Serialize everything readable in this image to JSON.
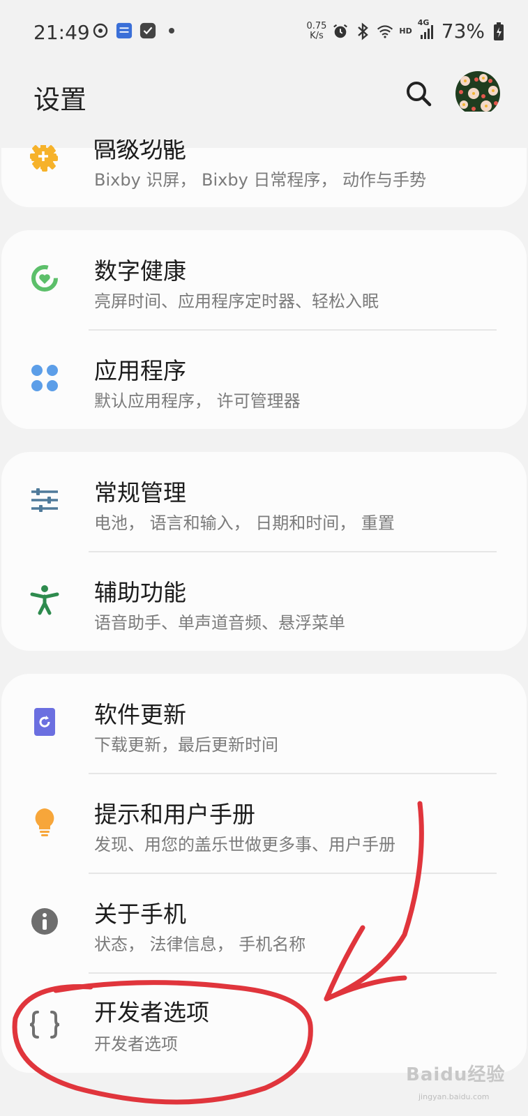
{
  "status_bar": {
    "time": "21:49",
    "speed_value": "0.75",
    "speed_unit": "K/s",
    "net_tag": "HD",
    "signal_tag": "4G",
    "battery": "73%",
    "icons": [
      "weibo-icon",
      "app-icon",
      "check-icon",
      "dot-icon",
      "alarm-icon",
      "bluetooth-icon",
      "wifi-icon",
      "signal-icon",
      "battery-icon"
    ]
  },
  "header": {
    "title": "设置",
    "search_icon": "search-icon",
    "avatar": "avatar"
  },
  "groups": [
    {
      "items": [
        {
          "title": "高级功能",
          "subtitle": "Bixby 识屏， Bixby 日常程序， 动作与手势",
          "icon": "advanced-features-icon",
          "color": "#f6b22a"
        }
      ]
    },
    {
      "items": [
        {
          "title": "数字健康",
          "subtitle": "亮屏时间、应用程序定时器、轻松入眠",
          "icon": "digital-wellbeing-icon",
          "color": "#5cbf6a"
        },
        {
          "title": "应用程序",
          "subtitle": "默认应用程序， 许可管理器",
          "icon": "apps-icon",
          "color": "#5c9ee8"
        }
      ]
    },
    {
      "items": [
        {
          "title": "常规管理",
          "subtitle": "电池， 语言和输入， 日期和时间， 重置",
          "icon": "general-management-icon",
          "color": "#4f7a9a"
        },
        {
          "title": "辅助功能",
          "subtitle": "语音助手、单声道音频、悬浮菜单",
          "icon": "accessibility-icon",
          "color": "#2e8b4e"
        }
      ]
    },
    {
      "items": [
        {
          "title": "软件更新",
          "subtitle": "下载更新，最后更新时间",
          "icon": "software-update-icon",
          "color": "#6b6fe0"
        },
        {
          "title": "提示和用户手册",
          "subtitle": "发现、用您的盖乐世做更多事、用户手册",
          "icon": "tips-icon",
          "color": "#f7a63a"
        },
        {
          "title": "关于手机",
          "subtitle": "状态， 法律信息， 手机名称",
          "icon": "about-phone-icon",
          "color": "#6e6e6e"
        },
        {
          "title": "开发者选项",
          "subtitle": "开发者选项",
          "icon": "developer-options-icon",
          "color": "#707070"
        }
      ]
    }
  ],
  "watermark": {
    "text": "Baidu经验",
    "sub": "jingyan.baidu.com"
  },
  "annotation_color": "#e0353c"
}
